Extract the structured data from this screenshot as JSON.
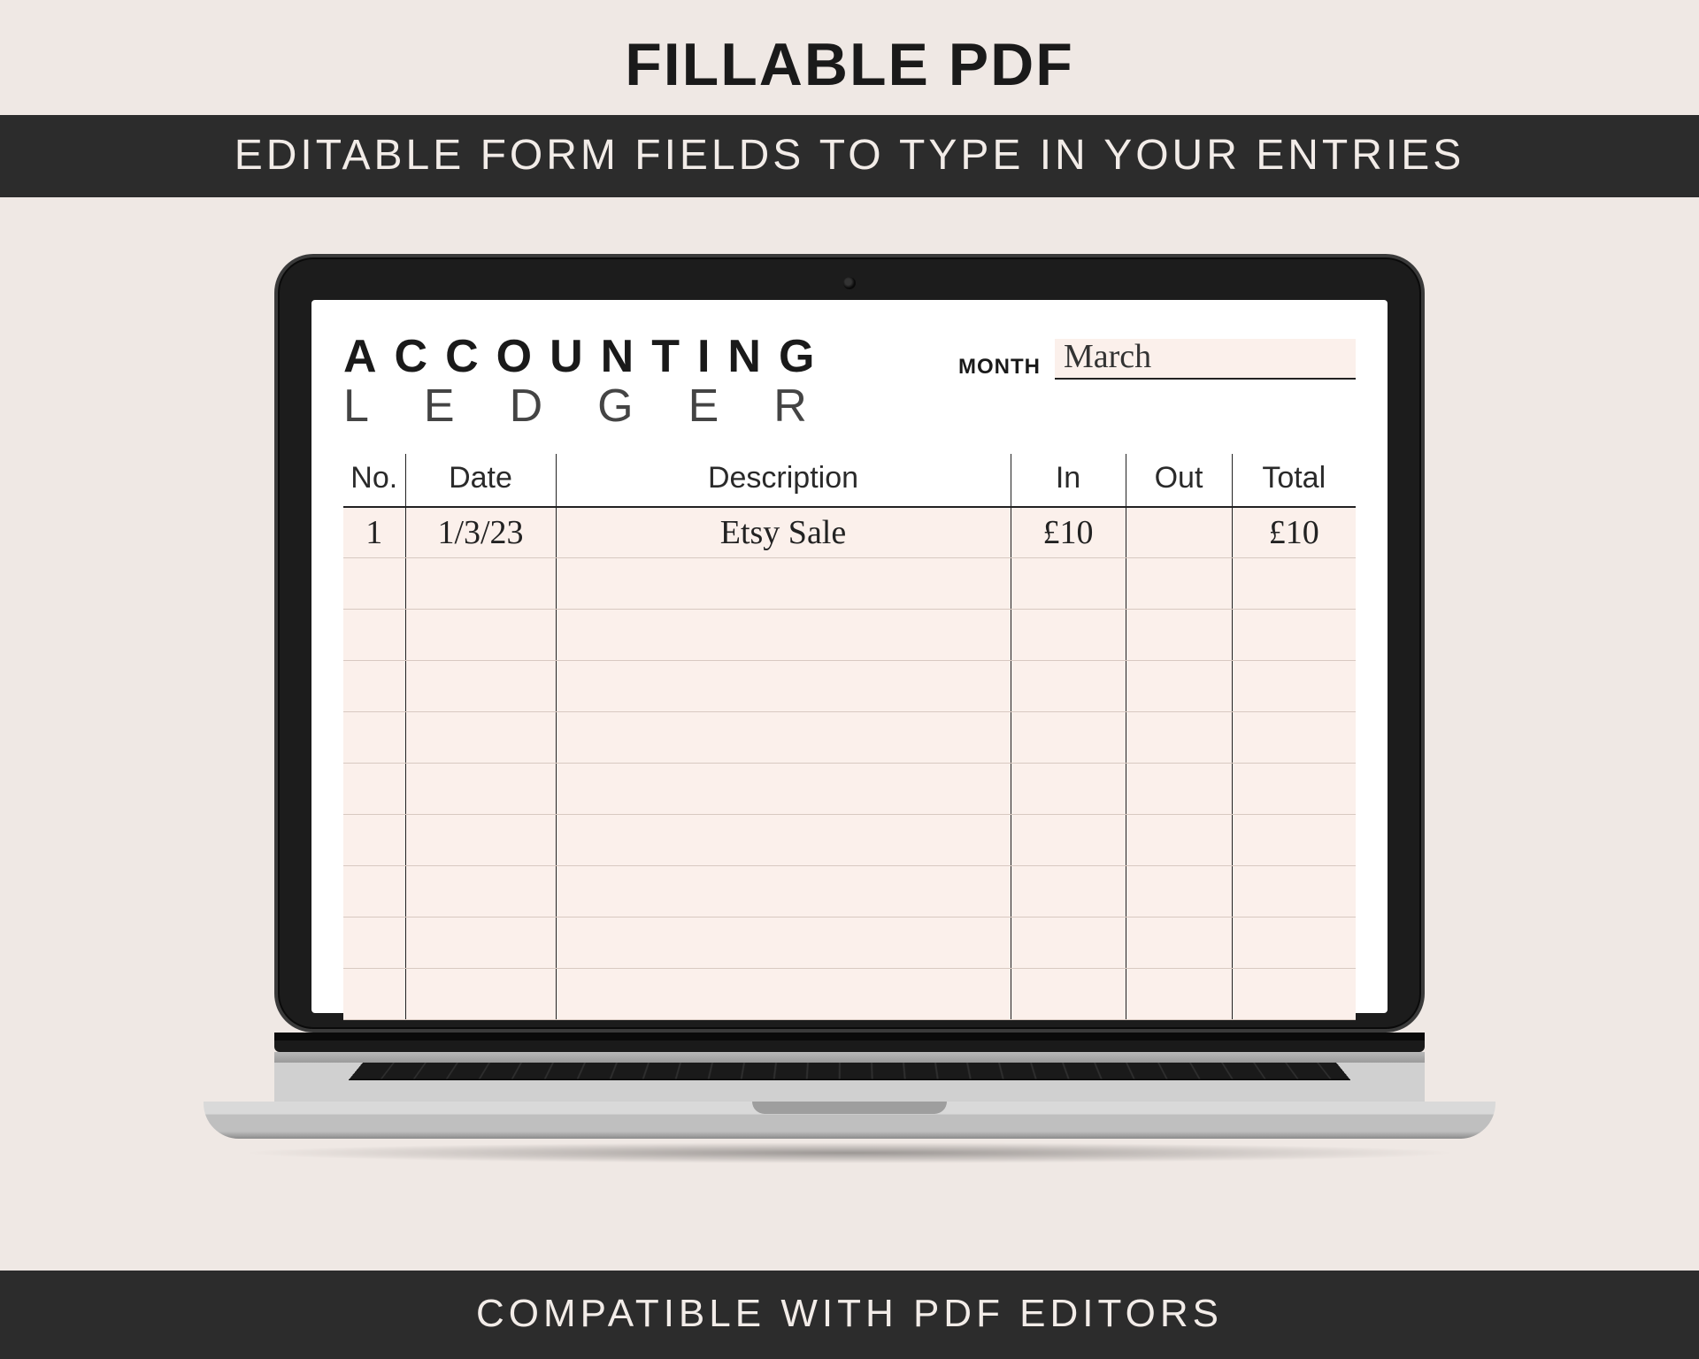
{
  "header": {
    "title": "FILLABLE PDF",
    "banner_top": "EDITABLE FORM FIELDS TO TYPE IN YOUR ENTRIES",
    "banner_bottom": "COMPATIBLE WITH PDF EDITORS"
  },
  "ledger": {
    "logo_line1": "ACCOUNTING",
    "logo_line2": "LEDGER",
    "month_label": "MONTH",
    "month_value": "March",
    "columns": {
      "no": "No.",
      "date": "Date",
      "description": "Description",
      "in": "In",
      "out": "Out",
      "total": "Total"
    },
    "rows": [
      {
        "no": "1",
        "date": "1/3/23",
        "description": "Etsy Sale",
        "in": "£10",
        "out": "",
        "total": "£10"
      },
      {
        "no": "",
        "date": "",
        "description": "",
        "in": "",
        "out": "",
        "total": ""
      },
      {
        "no": "",
        "date": "",
        "description": "",
        "in": "",
        "out": "",
        "total": ""
      },
      {
        "no": "",
        "date": "",
        "description": "",
        "in": "",
        "out": "",
        "total": ""
      },
      {
        "no": "",
        "date": "",
        "description": "",
        "in": "",
        "out": "",
        "total": ""
      },
      {
        "no": "",
        "date": "",
        "description": "",
        "in": "",
        "out": "",
        "total": ""
      },
      {
        "no": "",
        "date": "",
        "description": "",
        "in": "",
        "out": "",
        "total": ""
      },
      {
        "no": "",
        "date": "",
        "description": "",
        "in": "",
        "out": "",
        "total": ""
      },
      {
        "no": "",
        "date": "",
        "description": "",
        "in": "",
        "out": "",
        "total": ""
      },
      {
        "no": "",
        "date": "",
        "description": "",
        "in": "",
        "out": "",
        "total": ""
      }
    ]
  }
}
